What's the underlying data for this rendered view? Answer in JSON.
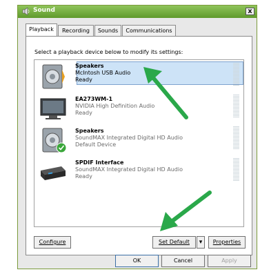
{
  "window": {
    "title": "Sound",
    "close_label": "x"
  },
  "tabs": [
    {
      "label": "Playback",
      "active": true
    },
    {
      "label": "Recording"
    },
    {
      "label": "Sounds"
    },
    {
      "label": "Communications"
    }
  ],
  "instructions": "Select a playback device below to modify its settings:",
  "devices": [
    {
      "name": "Speakers",
      "driver": "McIntosh USB Audio",
      "status": "Ready",
      "selected": true,
      "icon": "speaker-icon"
    },
    {
      "name": "EA273WM-1",
      "driver": "NVIDIA High Definition Audio",
      "status": "Ready",
      "icon": "monitor-icon"
    },
    {
      "name": "Speakers",
      "driver": "SoundMAX Integrated Digital HD Audio",
      "status": "Default Device",
      "icon": "speaker-default-icon"
    },
    {
      "name": "SPDIF Interface",
      "driver": "SoundMAX Integrated Digital HD Audio",
      "status": "Ready",
      "icon": "spdif-device-icon"
    }
  ],
  "buttons": {
    "configure": "Configure",
    "set_default": "Set Default",
    "dropdown": "▾",
    "properties": "Properties",
    "ok": "OK",
    "cancel": "Cancel",
    "apply": "Apply"
  },
  "colors": {
    "arrow": "#2aa84a",
    "selection": "#cde3f7"
  }
}
